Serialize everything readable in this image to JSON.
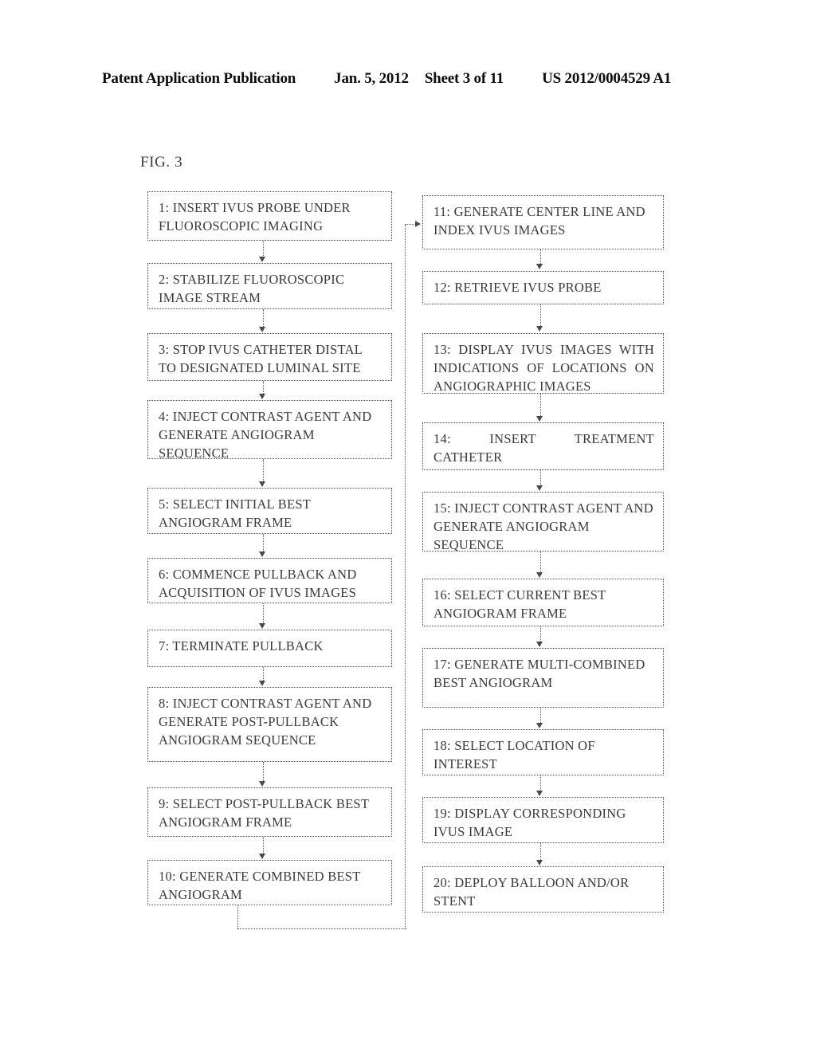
{
  "header": {
    "title": "Patent Application Publication",
    "date": "Jan. 5, 2012",
    "sheet": "Sheet 3 of 11",
    "publication_number": "US 2012/0004529 A1"
  },
  "figure": {
    "label": "FIG. 3"
  },
  "chart_data": {
    "type": "diagram",
    "title": "FIG. 3",
    "diagram_kind": "flowchart",
    "orientation": "two-column, top-to-bottom, left column then right column",
    "columns": 2,
    "node_count": 20,
    "edges": [
      "1->2",
      "2->3",
      "3->4",
      "4->5",
      "5->6",
      "6->7",
      "7->8",
      "8->9",
      "9->10",
      "10->11 (routed right and up the spine between columns)",
      "11->12",
      "12->13",
      "13->14",
      "14->15",
      "15->16",
      "16->17",
      "17->18",
      "18->19",
      "19->20"
    ]
  },
  "flowchart": {
    "left_column": [
      {
        "id": "1",
        "text": "1: INSERT IVUS PROBE UNDER FLUOROSCOPIC IMAGING",
        "align": "left"
      },
      {
        "id": "2",
        "text": "2: STABILIZE FLUOROSCOPIC IMAGE STREAM",
        "align": "left"
      },
      {
        "id": "3",
        "text": "3: STOP IVUS CATHETER DISTAL TO DESIGNATED LUMINAL SITE",
        "align": "left"
      },
      {
        "id": "4",
        "text": "4: INJECT CONTRAST AGENT AND GENERATE ANGIOGRAM SEQUENCE",
        "align": "left"
      },
      {
        "id": "5",
        "text": "5: SELECT INITIAL BEST ANGIOGRAM FRAME",
        "align": "left"
      },
      {
        "id": "6",
        "text": "6: COMMENCE PULLBACK AND ACQUISITION OF IVUS IMAGES",
        "align": "left"
      },
      {
        "id": "7",
        "text": "7: TERMINATE PULLBACK",
        "align": "left"
      },
      {
        "id": "8",
        "text": "8: INJECT CONTRAST AGENT AND GENERATE POST-PULLBACK ANGIOGRAM SEQUENCE",
        "align": "left"
      },
      {
        "id": "9",
        "text": "9: SELECT POST-PULLBACK BEST ANGIOGRAM FRAME",
        "align": "left"
      },
      {
        "id": "10",
        "text": "10: GENERATE COMBINED BEST ANGIOGRAM",
        "align": "left"
      }
    ],
    "right_column": [
      {
        "id": "11",
        "text": "11: GENERATE CENTER LINE AND INDEX IVUS IMAGES",
        "align": "left"
      },
      {
        "id": "12",
        "text": "12: RETRIEVE IVUS PROBE",
        "align": "left"
      },
      {
        "id": "13",
        "text": "13: DISPLAY IVUS IMAGES WITH INDICATIONS OF LOCATIONS ON ANGIOGRAPHIC IMAGES",
        "align": "justify"
      },
      {
        "id": "14",
        "text": "14: INSERT TREATMENT CATHETER",
        "align": "justify"
      },
      {
        "id": "15",
        "text": "15: INJECT CONTRAST AGENT AND GENERATE ANGIOGRAM SEQUENCE",
        "align": "left"
      },
      {
        "id": "16",
        "text": "16: SELECT CURRENT BEST ANGIOGRAM FRAME",
        "align": "left"
      },
      {
        "id": "17",
        "text": "17: GENERATE MULTI-COMBINED BEST ANGIOGRAM",
        "align": "left"
      },
      {
        "id": "18",
        "text": "18: SELECT LOCATION OF INTEREST",
        "align": "left"
      },
      {
        "id": "19",
        "text": "19: DISPLAY CORRESPONDING IVUS IMAGE",
        "align": "left"
      },
      {
        "id": "20",
        "text": "20: DEPLOY BALLOON AND/OR STENT",
        "align": "left"
      }
    ]
  }
}
